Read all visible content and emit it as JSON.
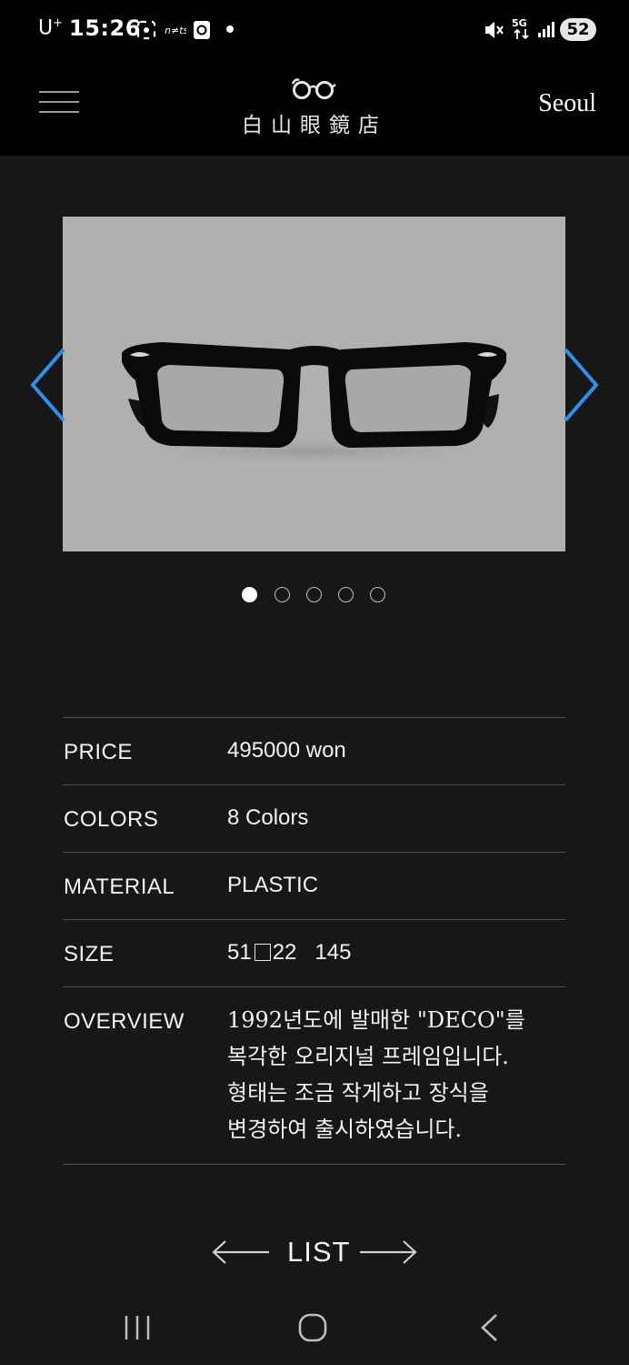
{
  "status_bar": {
    "carrier": "U",
    "carrier_sup": "+",
    "time": "15:26",
    "battery": "52",
    "network": "5G"
  },
  "header": {
    "logo_text": "白山眼鏡店",
    "city": "Seoul"
  },
  "carousel": {
    "image_description": "black-plastic-eyeglasses",
    "slide_count": 5,
    "active_slide": 1
  },
  "specs": {
    "price_label": "PRICE",
    "price_value": "495000 won",
    "colors_label": "COLORS",
    "colors_value": "8 Colors",
    "material_label": "MATERIAL",
    "material_value": "PLASTIC",
    "size_label": "SIZE",
    "size_lens": "51",
    "size_bridge": "22",
    "size_temple": "145",
    "overview_label": "OVERVIEW",
    "overview_lines": [
      "1992년도에 발매한 \"DECO\"를",
      "복각한 오리지널 프레임입니다.",
      "형태는 조금 작게하고 장식을",
      "변경하여 출시하였습니다."
    ]
  },
  "list_nav": {
    "label": "LIST"
  },
  "colors": {
    "accent_arrow": "#2f8fe8",
    "background": "#171717",
    "header_bg": "#000000",
    "image_bg": "#b0b0b0"
  }
}
